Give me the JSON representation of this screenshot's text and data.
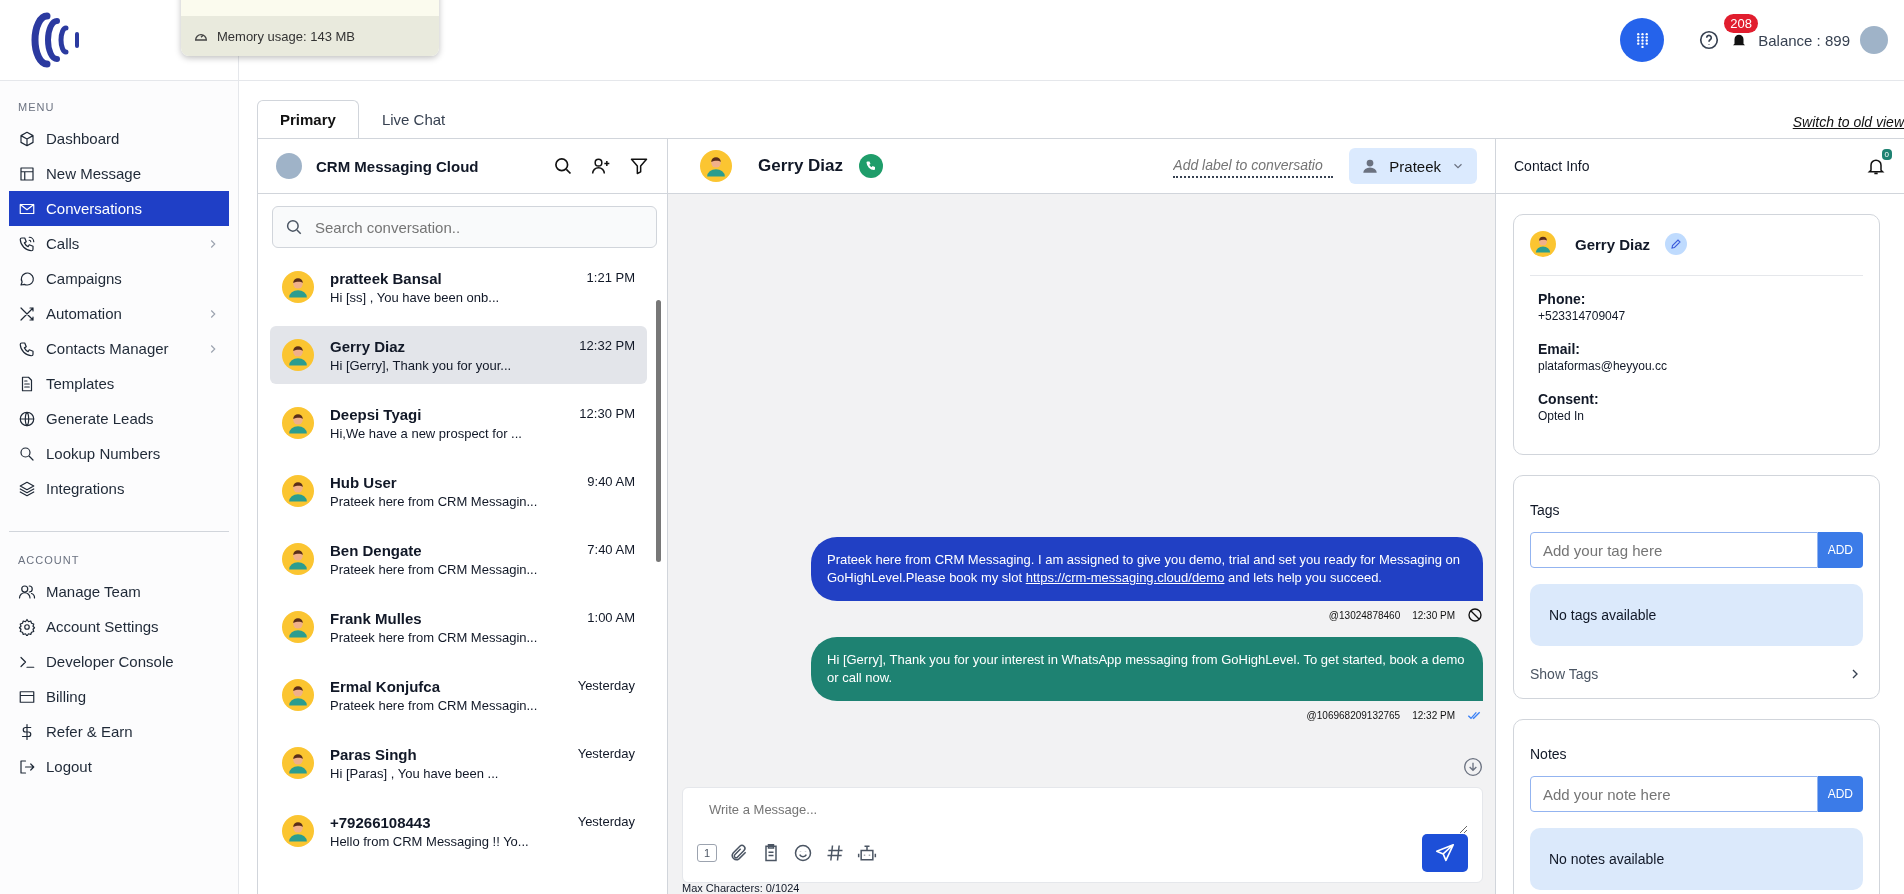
{
  "overlay": {
    "memory_usage": "Memory usage: 143 MB"
  },
  "topbar": {
    "notification_count": "208",
    "balance": "Balance : 899"
  },
  "sidebar": {
    "sections": [
      {
        "heading": "MENU",
        "items": [
          {
            "label": "Dashboard",
            "selected": false,
            "has_submenu": false
          },
          {
            "label": "New Message",
            "selected": false,
            "has_submenu": false
          },
          {
            "label": "Conversations",
            "selected": true,
            "has_submenu": false
          },
          {
            "label": "Calls",
            "selected": false,
            "has_submenu": true
          },
          {
            "label": "Campaigns",
            "selected": false,
            "has_submenu": false
          },
          {
            "label": "Automation",
            "selected": false,
            "has_submenu": true
          },
          {
            "label": "Contacts Manager",
            "selected": false,
            "has_submenu": true
          },
          {
            "label": "Templates",
            "selected": false,
            "has_submenu": false
          },
          {
            "label": "Generate Leads",
            "selected": false,
            "has_submenu": false
          },
          {
            "label": "Lookup Numbers",
            "selected": false,
            "has_submenu": false
          },
          {
            "label": "Integrations",
            "selected": false,
            "has_submenu": false
          }
        ]
      },
      {
        "heading": "ACCOUNT",
        "items": [
          {
            "label": "Manage Team",
            "selected": false,
            "has_submenu": false
          },
          {
            "label": "Account Settings",
            "selected": false,
            "has_submenu": false
          },
          {
            "label": "Developer Console",
            "selected": false,
            "has_submenu": false
          },
          {
            "label": "Billing",
            "selected": false,
            "has_submenu": false
          },
          {
            "label": "Refer & Earn",
            "selected": false,
            "has_submenu": false
          },
          {
            "label": "Logout",
            "selected": false,
            "has_submenu": false
          }
        ]
      }
    ]
  },
  "tabs": [
    {
      "label": "Primary",
      "selected": true
    },
    {
      "label": "Live Chat",
      "selected": false
    }
  ],
  "switch_view_link": "Switch to old view",
  "inbox": {
    "title": "CRM Messaging Cloud",
    "search": {
      "placeholder": "Search conversation.."
    },
    "conversations": [
      {
        "name": "pratteek Bansal",
        "preview": "Hi [ss] , You have been onb...",
        "time": "1:21 PM",
        "selected": false
      },
      {
        "name": "Gerry Diaz",
        "preview": "Hi [Gerry], Thank you for your...",
        "time": "12:32 PM",
        "selected": true
      },
      {
        "name": "Deepsi Tyagi",
        "preview": "Hi,We have a new prospect for ...",
        "time": "12:30 PM",
        "selected": false
      },
      {
        "name": "Hub User",
        "preview": "Prateek here from CRM Messagin...",
        "time": "9:40 AM",
        "selected": false
      },
      {
        "name": "Ben Dengate",
        "preview": "Prateek here from CRM Messagin...",
        "time": "7:40 AM",
        "selected": false
      },
      {
        "name": "Frank Mulles",
        "preview": "Prateek here from CRM Messagin...",
        "time": "1:00 AM",
        "selected": false
      },
      {
        "name": "Ermal Konjufca",
        "preview": "Prateek here from CRM Messagin...",
        "time": "Yesterday",
        "selected": false
      },
      {
        "name": "Paras Singh",
        "preview": "Hi [Paras] , You have been ...",
        "time": "Yesterday",
        "selected": false
      },
      {
        "name": "+79266108443",
        "preview": "Hello from CRM Messaging !! Yo...",
        "time": "Yesterday",
        "selected": false
      }
    ]
  },
  "chat": {
    "contact_name": "Gerry Diaz",
    "label_placeholder": "Add label to conversatio",
    "assignee": "Prateek",
    "messages": [
      {
        "text_before": "Prateek here from CRM Messaging. I am assigned to give you demo, trial and set you ready for Messaging on GoHighLevel.Please book my slot ",
        "link": "https://crm-messaging.cloud/demo",
        "text_after": " and lets help you succeed.",
        "color": "#2140c4",
        "sender": "@13024878460",
        "time": "12:30 PM",
        "kind": "failed"
      },
      {
        "text_before": "Hi [Gerry], Thank you for your interest in WhatsApp messaging from GoHighLevel. To get started, book a demo or call now.",
        "color": "#1e8272",
        "sender": "@106968209132765",
        "time": "12:32 PM",
        "kind": "read"
      }
    ],
    "composer": {
      "placeholder": "Write a Message...",
      "counter_key": "1",
      "max_characters": "Max Characters: 0/1024"
    }
  },
  "contact_info": {
    "title": "Contact Info",
    "alert_count": "0",
    "name": "Gerry Diaz",
    "fields": [
      {
        "label": "Phone:",
        "value": "+523314709047"
      },
      {
        "label": "Email:",
        "value": "plataformas@heyyou.cc"
      },
      {
        "label": "Consent:",
        "value": "Opted In"
      }
    ],
    "tags": {
      "title": "Tags",
      "placeholder": "Add your tag here",
      "button": "ADD",
      "empty": "No tags available",
      "show_link": "Show Tags"
    },
    "notes": {
      "title": "Notes",
      "placeholder": "Add your note here",
      "button": "ADD",
      "empty": "No notes available"
    }
  }
}
